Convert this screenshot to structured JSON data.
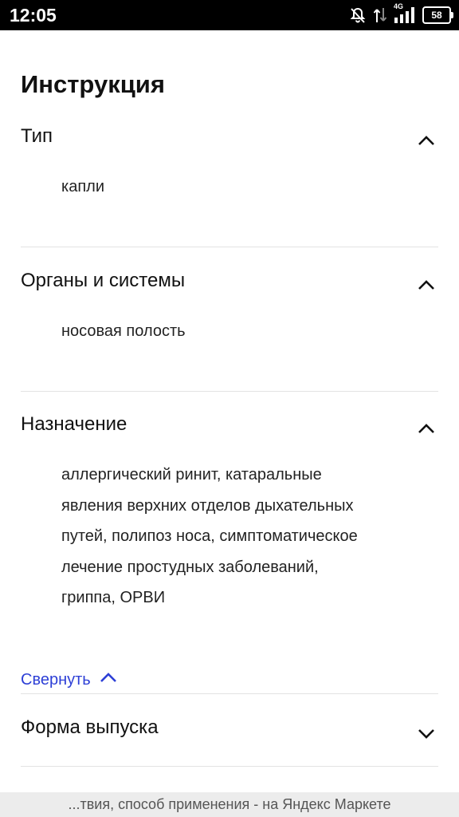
{
  "status_bar": {
    "time": "12:05",
    "network": "4G",
    "battery": "58",
    "icons": [
      "notifications-off-icon",
      "data-transfer-icon",
      "signal-icon",
      "battery-icon"
    ]
  },
  "page": {
    "title": "Инструкция"
  },
  "sections": [
    {
      "title": "Тип",
      "expanded": true,
      "content": "капли"
    },
    {
      "title": "Органы и системы",
      "expanded": true,
      "content": "носовая полость"
    },
    {
      "title": "Назначение",
      "expanded": true,
      "content_lines": [
        "аллергический ринит, катаральные",
        "явления верхних отделов дыхательных",
        "путей, полипоз носа, симптоматическое",
        "лечение простудных заболеваний,",
        "гриппа, ОРВИ"
      ]
    },
    {
      "title": "Форма выпуска",
      "expanded": false
    }
  ],
  "collapse_link": {
    "label": "Свернуть"
  },
  "footer": {
    "text": "...твия, способ применения - на Яндекс Маркете"
  },
  "colors": {
    "link": "#2d3fd6",
    "divider": "#e3e3e3",
    "footer_bg": "#ececec"
  }
}
